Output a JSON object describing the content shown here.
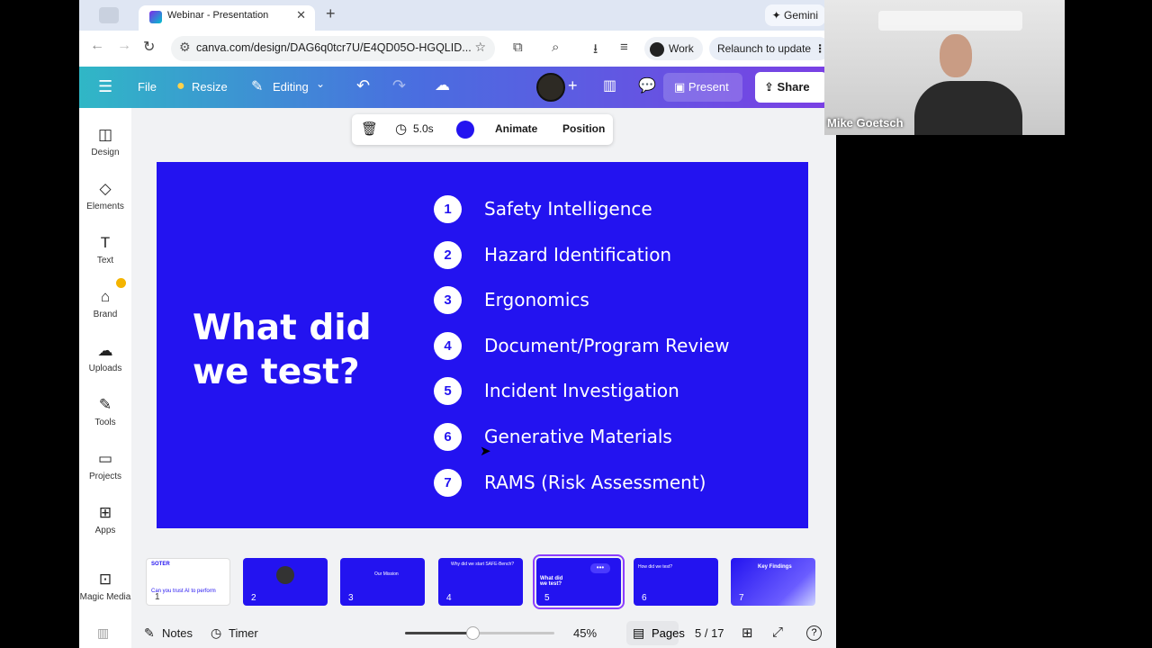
{
  "browser": {
    "tab_title": "Webinar - Presentation",
    "tab_close": "✕",
    "new_tab": "+",
    "gemini_label": "Gemini",
    "url": "canva.com/design/DAG6q0tcr7U/E4QD05O-HGQLID...",
    "profile_label": "Work",
    "relaunch_label": "Relaunch to update"
  },
  "canva_toolbar": {
    "file_label": "File",
    "resize_label": "Resize",
    "editing_label": "Editing",
    "present_label": "Present",
    "share_label": "Share"
  },
  "sidebar": {
    "items": [
      {
        "label": "Design",
        "icon": "design-icon"
      },
      {
        "label": "Elements",
        "icon": "elements-icon"
      },
      {
        "label": "Text",
        "icon": "text-icon"
      },
      {
        "label": "Brand",
        "icon": "brand-icon"
      },
      {
        "label": "Uploads",
        "icon": "uploads-icon"
      },
      {
        "label": "Tools",
        "icon": "tools-icon"
      },
      {
        "label": "Projects",
        "icon": "projects-icon"
      },
      {
        "label": "Apps",
        "icon": "apps-icon"
      },
      {
        "label": "Magic Media",
        "icon": "magic-media-icon"
      }
    ]
  },
  "context_toolbar": {
    "duration": "5.0s",
    "color": "#2313f0",
    "animate_label": "Animate",
    "position_label": "Position"
  },
  "slide": {
    "background": "#2313f0",
    "title_line1": "What did",
    "title_line2": "we test?",
    "items": [
      {
        "num": "1",
        "text": "Safety Intelligence"
      },
      {
        "num": "2",
        "text": "Hazard Identification"
      },
      {
        "num": "3",
        "text": "Ergonomics"
      },
      {
        "num": "4",
        "text": "Document/Program Review"
      },
      {
        "num": "5",
        "text": "Incident Investigation"
      },
      {
        "num": "6",
        "text": "Generative Materials"
      },
      {
        "num": "7",
        "text": "RAMS (Risk Assessment)"
      }
    ]
  },
  "thumbnails": [
    {
      "num": "1",
      "caption": "Can you trust AI to perform",
      "brand": "SOTER"
    },
    {
      "num": "2",
      "caption": ""
    },
    {
      "num": "3",
      "caption": "Our Mission"
    },
    {
      "num": "4",
      "caption": "Why did we start SAFE-Bench?"
    },
    {
      "num": "5",
      "caption": "What did we test?"
    },
    {
      "num": "6",
      "caption": "How did we test?"
    },
    {
      "num": "7",
      "caption": "Key Findings"
    }
  ],
  "bottom_bar": {
    "notes_label": "Notes",
    "timer_label": "Timer",
    "zoom": "45%",
    "zoom_level": 0.45,
    "pages_label": "Pages",
    "page_indicator": "5 / 17",
    "help": "?"
  },
  "webcam": {
    "name": "Mike Goetsch"
  }
}
